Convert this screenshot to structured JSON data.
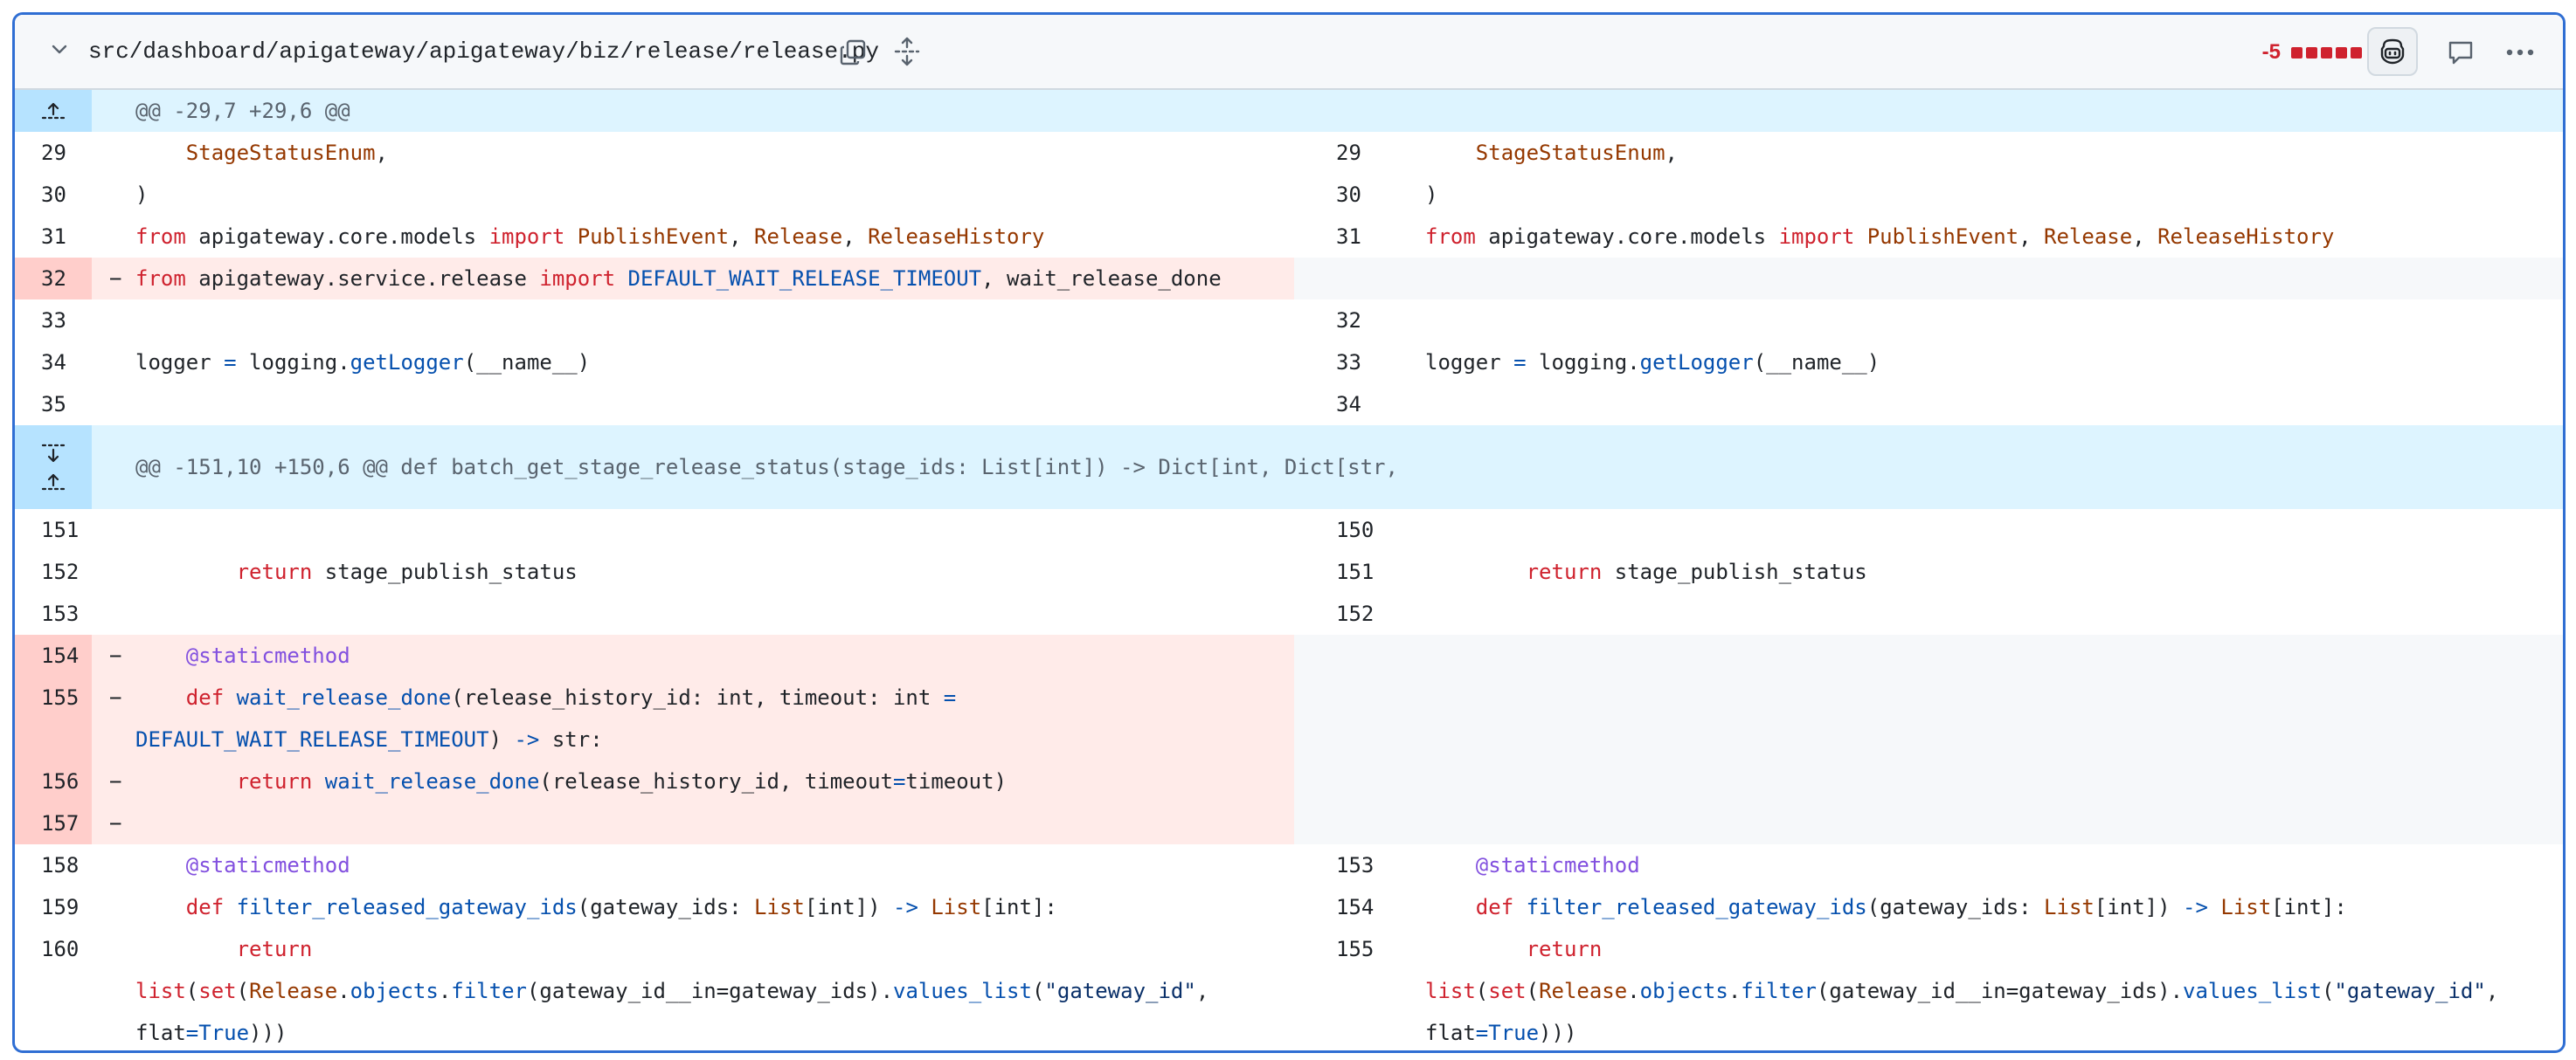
{
  "file": {
    "path": "src/dashboard/apigateway/apigateway/biz/release/release.py",
    "diff_stat": "-5",
    "icons": {
      "collapse": "chevron-down-icon",
      "copy": "copy-icon",
      "expand": "unfold-icon",
      "copilot": "copilot-icon",
      "comment": "comment-icon",
      "more": "kebab-horizontal-icon"
    }
  },
  "hunks": [
    {
      "header": "@@ -29,7 +29,6 @@"
    },
    {
      "header": "@@ -151,10 +150,6 @@ def batch_get_stage_release_status(stage_ids: List[int]) -> Dict[int, Dict[str,"
    }
  ],
  "lines": {
    "l29": "29",
    "l30": "30",
    "l31": "31",
    "l32": "32",
    "l33": "33",
    "l34": "34",
    "l35": "35",
    "r29": "29",
    "r30": "30",
    "r31": "31",
    "r32": "32",
    "r33": "33",
    "r34": "34",
    "l151": "151",
    "l152": "152",
    "l153": "153",
    "l154": "154",
    "l155": "155",
    "l156": "156",
    "l157": "157",
    "l158": "158",
    "l159": "159",
    "l160": "160",
    "r150": "150",
    "r151": "151",
    "r152": "152",
    "r153": "153",
    "r154": "154",
    "r155": "155"
  },
  "code": {
    "stage_status_enum": "StageStatusEnum",
    "comma": ",",
    "close_paren": ")",
    "from": "from",
    "import": "import",
    "core_models": " apigateway.core.models ",
    "publish_event": "PublishEvent",
    "release": "Release",
    "release_history": "ReleaseHistory",
    "sep": ", ",
    "service_release": " apigateway.service.release ",
    "default_timeout": "DEFAULT_WAIT_RELEASE_TIMEOUT",
    "wait_done_tail": ", wait_release_done",
    "logger": "logger ",
    "eq": "=",
    "logging": " logging.",
    "get_logger": "getLogger",
    "name_arg": "(__name__)",
    "return": "return",
    "stage_publish_status": " stage_publish_status",
    "staticmethod": "@staticmethod",
    "def": "def",
    "wait_release_done": "wait_release_done",
    "wait_sig": "(release_history_id: int, timeout: int ",
    "arrow": "->",
    "str_tail": " str:",
    "wait_call_args": "(release_history_id, timeout",
    "timeout_tail": "timeout)",
    "filter_fn": "filter_released_gateway_ids",
    "filter_sig": "(gateway_ids: ",
    "list_type": "List",
    "int_close": "[int]) ",
    "int_colon": "[int]:",
    "list_fn": "list",
    "set_fn": "set",
    "objects": "objects",
    "filter": "filter",
    "gateway_args": "(gateway_id__in=gateway_ids).",
    "values_list": "values_list",
    "gateway_id_str": "\"gateway_id\"",
    "flat": "flat",
    "true": "True",
    "end_parens": ")))",
    "dot": ".",
    "open_paren": "(",
    "minus": "−"
  }
}
